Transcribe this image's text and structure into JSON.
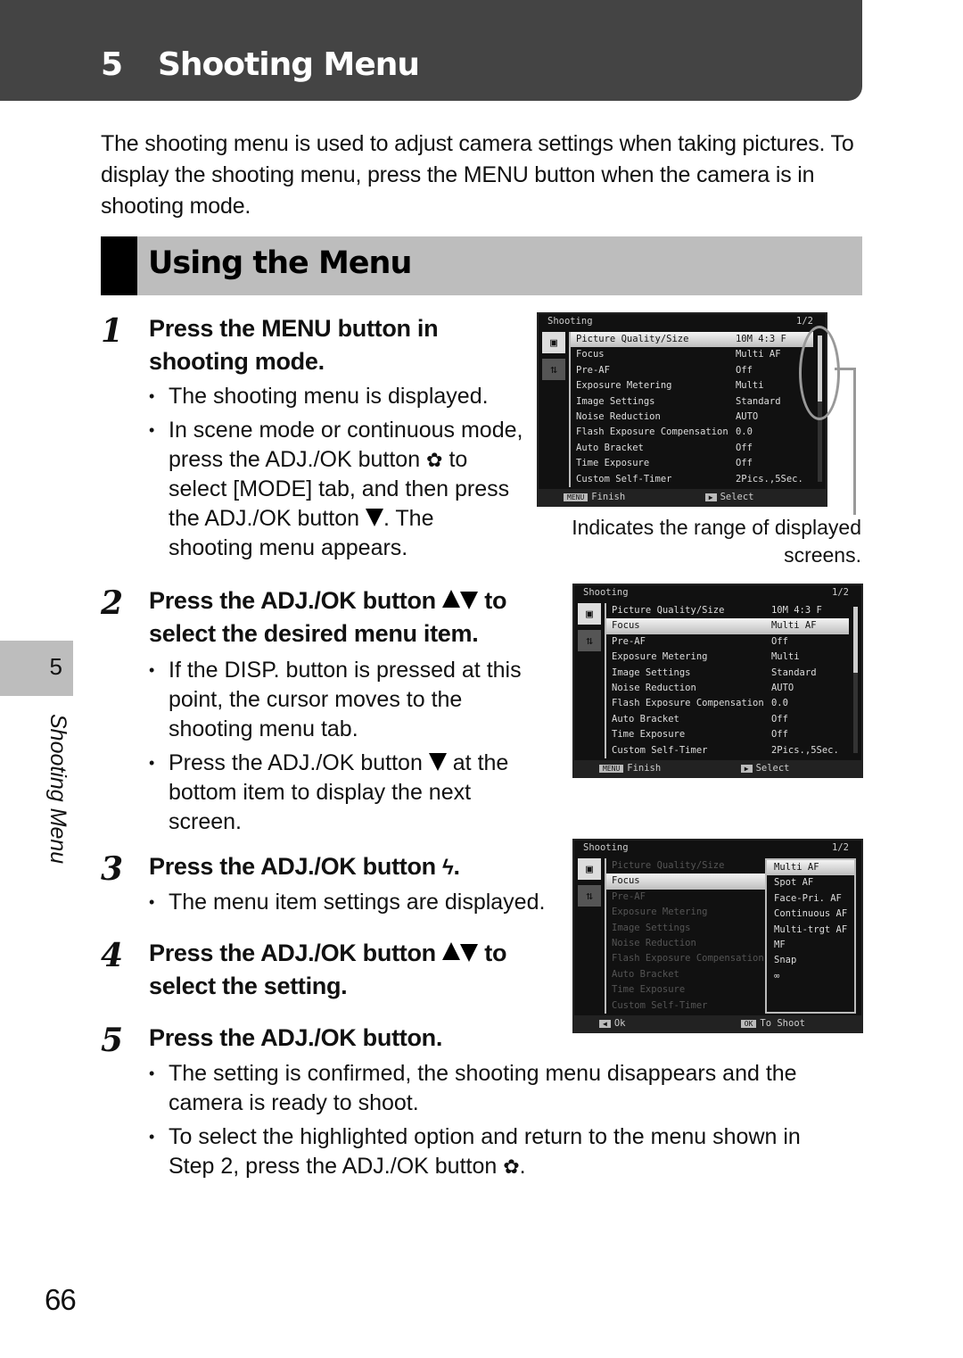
{
  "header": {
    "chapter_number": "5",
    "chapter_title": "Shooting Menu"
  },
  "intro": "The shooting menu is used to adjust camera settings when taking pictures. To display the shooting menu, press the MENU button when the camera is in shooting mode.",
  "section": {
    "title": "Using the Menu"
  },
  "steps": [
    {
      "number": "1",
      "heading": "Press the MENU button in shooting mode.",
      "bullets": [
        "The shooting menu is displayed.",
        "In scene mode or continuous mode, press the ADJ./OK button",
        "to select [MODE] tab, and then press the ADJ./OK button",
        ". The shooting menu appears."
      ]
    },
    {
      "number": "2",
      "heading_a": "Press the ADJ./OK button",
      "heading_b": "to select the desired menu item.",
      "bullets": [
        "If the DISP. button is pressed at this point, the cursor moves to the shooting menu tab.",
        "Press the ADJ./OK button",
        "at the bottom item to display the next screen."
      ]
    },
    {
      "number": "3",
      "heading": "Press the ADJ./OK button",
      "bullets": [
        "The menu item settings are displayed."
      ]
    },
    {
      "number": "4",
      "heading_a": "Press the ADJ./OK button",
      "heading_b": "to select the setting."
    },
    {
      "number": "5",
      "heading": "Press the ADJ./OK button.",
      "bullets": [
        "The setting is confirmed, the shooting menu disappears and the camera is ready to shoot.",
        "To select the highlighted option and return to the menu shown in Step 2, press the ADJ./OK button"
      ]
    }
  ],
  "icons": {
    "macro": "✿",
    "down": "down-triangle",
    "up": "up-triangle",
    "flash": "ϟ"
  },
  "callout": "Indicates the range of displayed screens.",
  "screens": {
    "title": "Shooting",
    "page": "1/2",
    "items": [
      {
        "label": "Picture Quality/Size",
        "value": "10M 4:3 F"
      },
      {
        "label": "Focus",
        "value": "Multi AF"
      },
      {
        "label": "Pre-AF",
        "value": "Off"
      },
      {
        "label": "Exposure Metering",
        "value": "Multi"
      },
      {
        "label": "Image Settings",
        "value": "Standard"
      },
      {
        "label": "Noise Reduction",
        "value": "AUTO"
      },
      {
        "label": "Flash Exposure Compensation",
        "value": "0.0"
      },
      {
        "label": "Auto Bracket",
        "value": "Off"
      },
      {
        "label": "Time Exposure",
        "value": "Off"
      },
      {
        "label": "Custom Self-Timer",
        "value": "2Pics.,5Sec."
      }
    ],
    "footer_left": "Finish",
    "footer_right": "Select",
    "footer_left_key": "MENU",
    "focus_options": [
      "Multi AF",
      "Spot AF",
      "Face-Pri. AF",
      "Continuous AF",
      "Multi-trgt AF",
      "MF",
      "Snap",
      "∞"
    ],
    "sub_footer_left": "Ok",
    "sub_footer_right": "To Shoot",
    "sub_footer_right_key": "OK"
  },
  "side_tab": {
    "number": "5",
    "label": "Shooting Menu"
  },
  "page_number": "66"
}
